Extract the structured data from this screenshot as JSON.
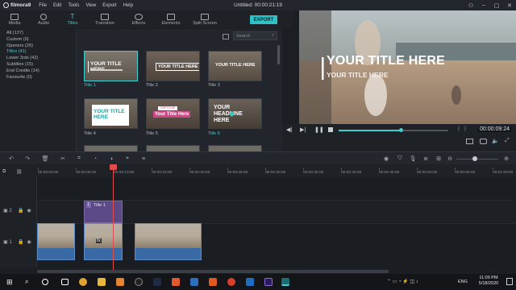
{
  "app": {
    "logo": "filmora9",
    "menus": [
      "File",
      "Edit",
      "Tools",
      "View",
      "Export",
      "Help"
    ],
    "doc_title": "Untitled:",
    "timecode": "00:00:21:19",
    "export_label": "EXPORT"
  },
  "tabs": [
    {
      "label": "Media",
      "icon": "media-icon",
      "active": false
    },
    {
      "label": "Audio",
      "icon": "music-icon",
      "active": false
    },
    {
      "label": "Titles",
      "icon": "titles-icon",
      "active": true
    },
    {
      "label": "Transition",
      "icon": "transition-icon",
      "active": false
    },
    {
      "label": "Effects",
      "icon": "effects-icon",
      "active": false
    },
    {
      "label": "Elements",
      "icon": "elements-icon",
      "active": false
    },
    {
      "label": "Split Screen",
      "icon": "split-screen-icon",
      "active": false
    }
  ],
  "categories": [
    {
      "label": "All (137)",
      "active": false
    },
    {
      "label": "Custom (0)",
      "active": false
    },
    {
      "label": "Openers (25)",
      "active": false
    },
    {
      "label": "Titles (41)",
      "active": true
    },
    {
      "label": "Lower 3rds (42)",
      "active": false
    },
    {
      "label": "Subtitles (15)",
      "active": false
    },
    {
      "label": "End Credits (14)",
      "active": false
    },
    {
      "label": "Favourite (0)",
      "active": false
    }
  ],
  "search": {
    "placeholder": "Search"
  },
  "thumbnails": [
    {
      "label": "Title 1",
      "text": "YOUR TITLE HERE",
      "selected": true
    },
    {
      "label": "Title 2",
      "text": "YOUR TITLE HERE",
      "selected": false
    },
    {
      "label": "Title 3",
      "text": "YOUR TITLE HERE",
      "selected": false
    },
    {
      "label": "Title 4",
      "text": "YOUR TITLE HERE",
      "selected": false
    },
    {
      "label": "Title 5",
      "text": "Your Title Here",
      "selected": false
    },
    {
      "label": "Title 6",
      "text": "YOUR HEADLINE HERE",
      "selected": false
    }
  ],
  "title5_tag": "TOP TO BE",
  "preview": {
    "title": "YOUR TITLE HERE",
    "subtitle": "YOUR TITLE HERE",
    "time": "00:00:09:24",
    "progress": 0.57
  },
  "ruler_ticks": [
    "00:00:00:00",
    "00:00:05:00",
    "00:00:10:00",
    "00:00:15:00",
    "00:00:20:00",
    "00:00:25:00",
    "00:00:30:00",
    "00:00:35:00",
    "00:00:40:00",
    "00:00:45:00",
    "00:00:50:00",
    "00:00:55:00",
    "00:01:00:00"
  ],
  "tracks": {
    "track2_label": "2",
    "track1_label": "1",
    "title_clip_label": "Title 1"
  },
  "taskbar": {
    "lang": "ENG",
    "time": "11:09 PM",
    "date": "5/18/2020"
  },
  "colors": {
    "accent": "#3ecfd3",
    "playhead": "#e14b4b",
    "video_clip": "#4a79b8",
    "title_clip": "#5c4a86"
  }
}
